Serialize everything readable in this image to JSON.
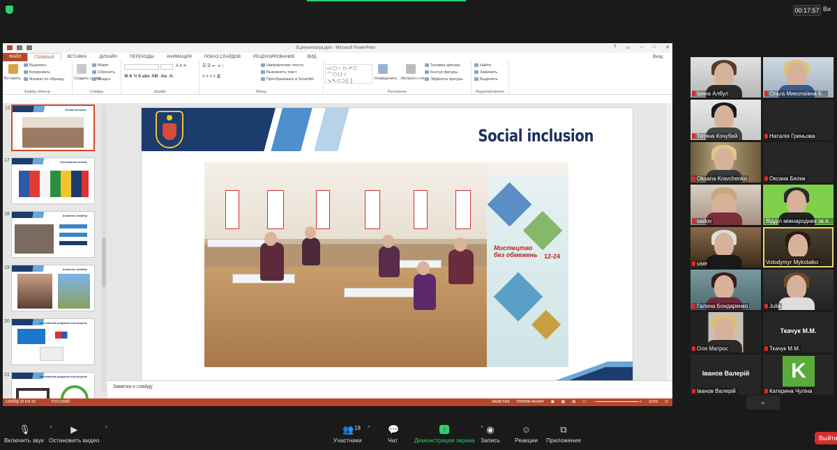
{
  "meeting": {
    "timer": "00:17:57",
    "view_label": "Ви",
    "brand_green": "#2bd16b"
  },
  "ppt": {
    "window_title": "5Lpresentacija.pptx - Microsoft PowerPoint",
    "sign_in": "Вход",
    "tabs": [
      "ФАЙЛ",
      "ГЛАВНАЯ",
      "ВСТАВКА",
      "ДИЗАЙН",
      "ПЕРЕХОДЫ",
      "АНИМАЦИЯ",
      "ПОКАЗ СЛАЙДОВ",
      "РЕЦЕНЗИРОВАНИЕ",
      "ВИД"
    ],
    "ribbon": {
      "paste": "Вставить",
      "cut": "Вырезать",
      "copy": "Копировать",
      "format_painter": "Формат по образцу",
      "clipboard": "Буфер обмена",
      "new_slide": "Создать слайд",
      "layout": "Макет",
      "reset": "Сбросить",
      "section": "Раздел",
      "slides": "Слайды",
      "font": "Шрифт",
      "text_direction": "Направление текста",
      "align_text": "Выровнять текст",
      "smartart": "Преобразовать в SmartArt",
      "paragraph": "Абзац",
      "arrange": "Упорядочить",
      "quick_styles": "Экспресс-стили",
      "shape_fill": "Заливка фигуры",
      "shape_outline": "Контур фигуры",
      "shape_effects": "Эффекты фигуры",
      "drawing": "Рисование",
      "find": "Найти",
      "replace": "Заменить",
      "select": "Выделить",
      "editing": "Редактирование"
    },
    "thumbnails": [
      {
        "num": "16",
        "title": "Social inclusion"
      },
      {
        "num": "17",
        "title": "International activity"
      },
      {
        "num": "18",
        "title": "Academic mobility"
      },
      {
        "num": "19",
        "title": "Academic mobility"
      },
      {
        "num": "20",
        "title": "International programs and projects"
      },
      {
        "num": "21",
        "title": "International programs and projects"
      }
    ],
    "slide": {
      "title": "Social inclusion",
      "poster_text": "Мистецтво без обмежень",
      "poster_dates": "12-24"
    },
    "notes_placeholder": "Заметки к слайду",
    "status": {
      "slide_of": "СЛАЙД 16 ИЗ 33",
      "language": "РУССКИЙ",
      "notes": "ЗАМЕТКИ",
      "comments": "ПРИМЕЧАНИЯ",
      "zoom": "110%"
    },
    "accent": "#b7472a"
  },
  "participants": [
    {
      "name": "Ірина Албул",
      "muted": true,
      "video": true
    },
    {
      "name": "Ольга Миколаївна Б...",
      "muted": true,
      "video": true
    },
    {
      "name": "Тетяна Кочубей",
      "muted": true,
      "video": true
    },
    {
      "name": "Наталія Гриньова",
      "muted": true,
      "video": false
    },
    {
      "name": "Oksana Kravchenko",
      "muted": true,
      "video": true
    },
    {
      "name": "Оксана Бялик",
      "muted": true,
      "video": false
    },
    {
      "name": "sadov",
      "muted": true,
      "video": true
    },
    {
      "name": "Відділ міжнародних зв.я...",
      "muted": true,
      "video": true
    },
    {
      "name": "user",
      "muted": true,
      "video": true
    },
    {
      "name": "Volodymyr Mykolaiko",
      "muted": false,
      "video": true,
      "active": true
    },
    {
      "name": "Галина Бондаренко",
      "muted": true,
      "video": true
    },
    {
      "name": "Julia",
      "muted": true,
      "video": true
    },
    {
      "name": "Оля Матрос",
      "muted": true,
      "video": true
    },
    {
      "name": "Ткачук М.М.",
      "muted": true,
      "video": false,
      "display": "Ткачук М.М."
    },
    {
      "name": "Іванов Валерій",
      "muted": true,
      "video": false,
      "display": "Іванов Валерій"
    },
    {
      "name": "Катерина Чуліна",
      "muted": true,
      "video": false,
      "avatar_letter": "K"
    }
  ],
  "toolbar": {
    "unmute": "Включить звук",
    "stop_video": "Остановить видео",
    "participants": "Участники",
    "participants_count": "18",
    "chat": "Чат",
    "share": "Демонстрация экрана",
    "record": "Запись",
    "reactions": "Реакции",
    "apps": "Приложения",
    "exit": "Выйти"
  }
}
